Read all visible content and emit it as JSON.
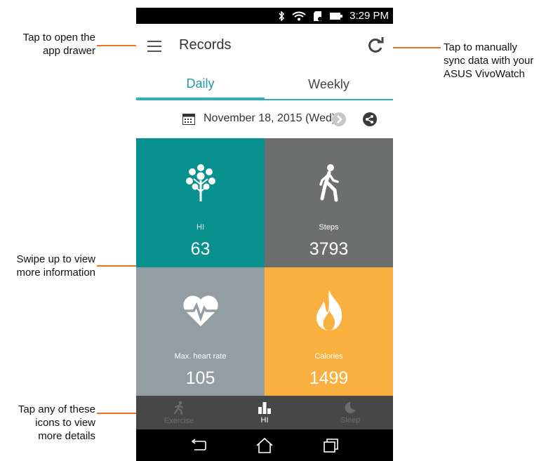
{
  "callouts": {
    "drawer": "Tap to open the\napp drawer",
    "sync": "Tap to manually\nsync data with your\nASUS VivoWatch",
    "swipe": "Swipe up to view\nmore information",
    "icons": "Tap any of these\nicons to view\nmore details"
  },
  "status_bar": {
    "time": "3:29 PM"
  },
  "app_bar": {
    "title": "Records"
  },
  "tabs": [
    {
      "label": "Daily",
      "active": true
    },
    {
      "label": "Weekly",
      "active": false
    }
  ],
  "date": {
    "text": "November 18, 2015 (Wed)"
  },
  "tiles": [
    {
      "label": "HI",
      "value": "63",
      "color": "#08918f",
      "icon": "tree-icon"
    },
    {
      "label": "Steps",
      "value": "3793",
      "color": "#6d6e6e",
      "icon": "walking-person-icon"
    },
    {
      "label": "Max. heart rate",
      "value": "105",
      "color": "#929ea2",
      "icon": "heartbeat-icon"
    },
    {
      "label": "Calories",
      "value": "1499",
      "color": "#f9b03e",
      "icon": "flame-icon"
    }
  ],
  "bottom_nav": [
    {
      "label": "Exercise",
      "icon": "running-icon",
      "active": false
    },
    {
      "label": "HI",
      "icon": "bar-chart-icon",
      "active": true
    },
    {
      "label": "Sleep",
      "icon": "moon-icon",
      "active": false
    }
  ],
  "colors": {
    "accent": "#2fb0c2",
    "callout": "#e8722a"
  }
}
